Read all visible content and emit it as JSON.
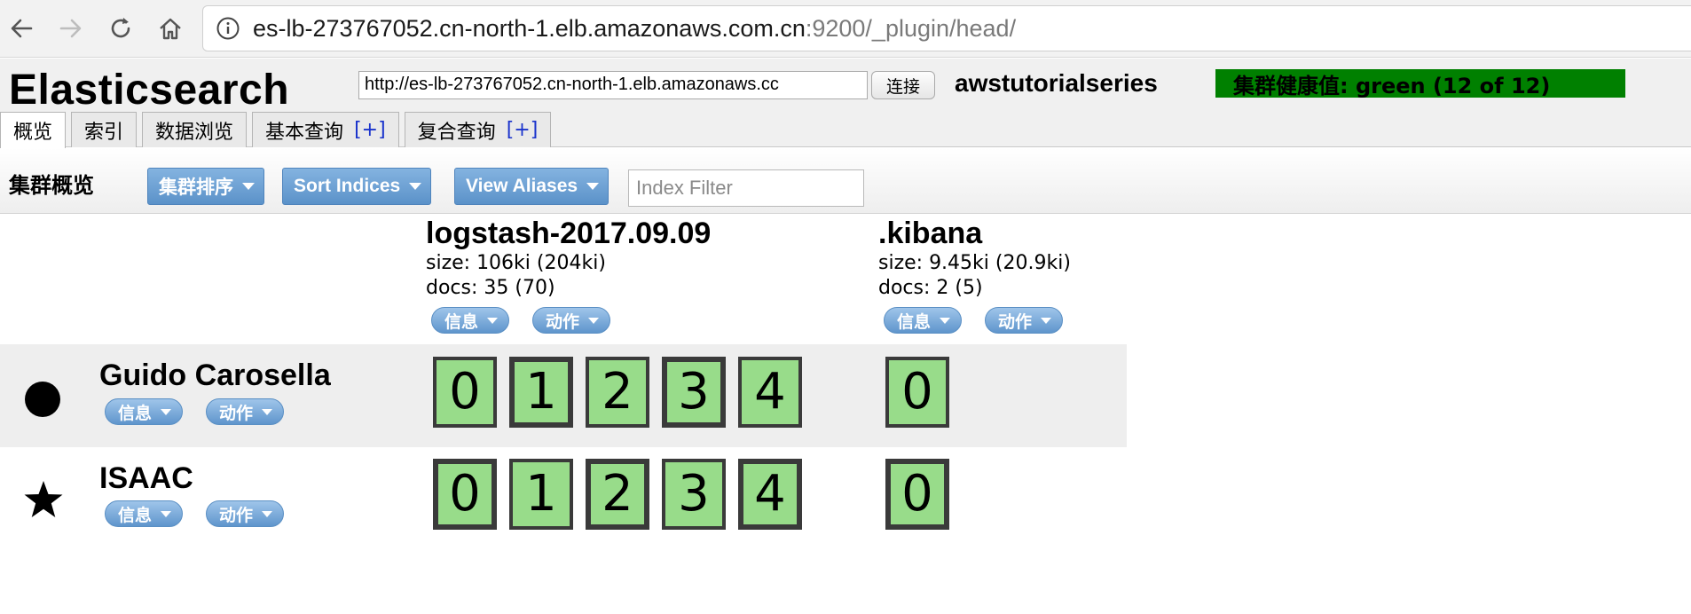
{
  "browser": {
    "url_host": "es-lb-273767052.cn-north-1.elb.amazonaws.com.cn",
    "url_path": ":9200/_plugin/head/"
  },
  "app": {
    "title": "Elasticsearch",
    "connect_url": "http://es-lb-273767052.cn-north-1.elb.amazonaws.cc",
    "connect_label": "连接",
    "cluster_name": "awstutorialseries",
    "health": "集群健康值: green (12 of 12)",
    "health_color": "#008000"
  },
  "tabs": [
    {
      "label": "概览",
      "plus": ""
    },
    {
      "label": "索引",
      "plus": ""
    },
    {
      "label": "数据浏览",
      "plus": ""
    },
    {
      "label": "基本查询",
      "plus": "[+]"
    },
    {
      "label": "复合查询",
      "plus": "[+]"
    }
  ],
  "toolbar": {
    "title": "集群概览",
    "sort_cluster": "集群排序",
    "sort_indices": "Sort Indices",
    "view_aliases": "View Aliases",
    "filter_placeholder": "Index Filter"
  },
  "indices": [
    {
      "name": "logstash-2017.09.09",
      "size": "size: 106ki (204ki)",
      "docs": "docs: 35 (70)",
      "info": "信息",
      "action": "动作"
    },
    {
      "name": ".kibana",
      "size": "size: 9.45ki (20.9ki)",
      "docs": "docs: 2 (5)",
      "info": "信息",
      "action": "动作"
    }
  ],
  "nodes": [
    {
      "name": "Guido Carosella",
      "icon": "circle-icon",
      "info": "信息",
      "action": "动作",
      "logstash_shards": [
        "0",
        "1",
        "2",
        "3",
        "4"
      ],
      "kibana_shards": [
        "0"
      ],
      "logstash_primary": [
        false,
        true,
        false,
        true,
        false
      ],
      "kibana_primary": [
        false
      ]
    },
    {
      "name": "ISAAC",
      "icon": "star-icon",
      "info": "信息",
      "action": "动作",
      "logstash_shards": [
        "0",
        "1",
        "2",
        "3",
        "4"
      ],
      "kibana_shards": [
        "0"
      ],
      "logstash_primary": [
        true,
        false,
        true,
        false,
        true
      ],
      "kibana_primary": [
        true
      ]
    }
  ],
  "colors": {
    "shard_green": "#98dc8a",
    "button_blue": "#5b92c9"
  }
}
